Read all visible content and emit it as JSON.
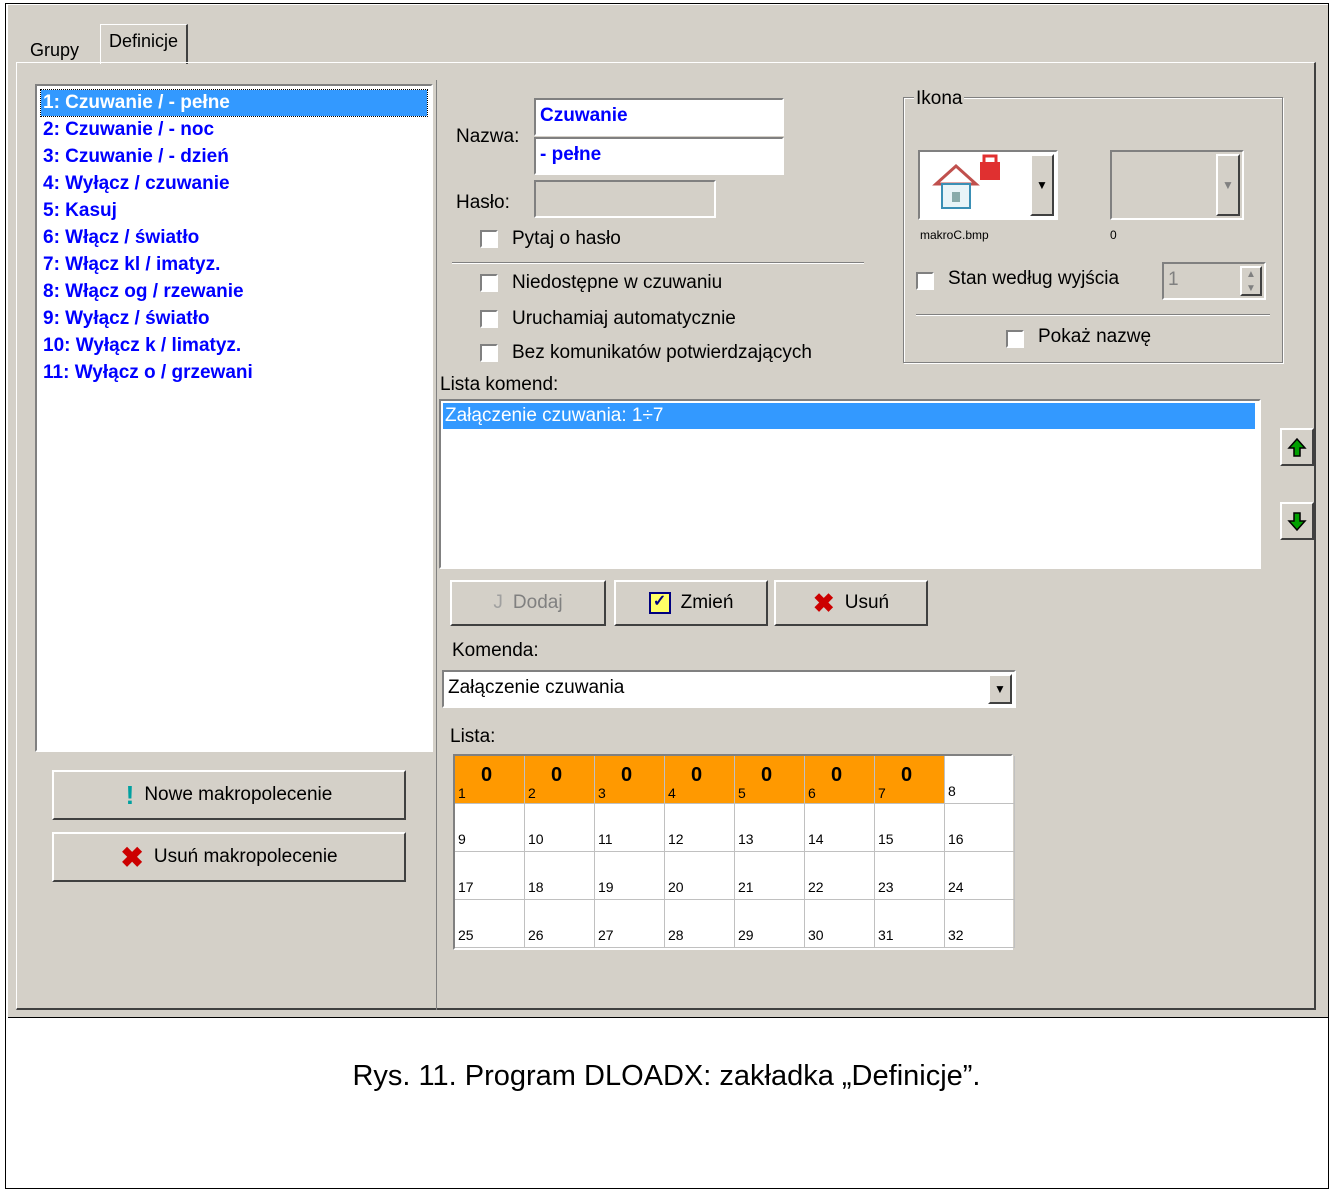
{
  "tabs": [
    {
      "label": "Grupy",
      "active": false
    },
    {
      "label": "Definicje",
      "active": true
    }
  ],
  "macro_list": {
    "items": [
      "1: Czuwanie /  - pełne",
      "2: Czuwanie /  - noc",
      "3: Czuwanie /  - dzień",
      "4: Wyłącz / czuwanie",
      "5: Kasuj",
      "6: Włącz  / światło",
      "7: Włącz kl / imatyz.",
      "8: Włącz og / rzewanie",
      "9: Wyłącz / światło",
      "10: Wyłącz k / limatyz.",
      "11: Wyłącz o / grzewani"
    ],
    "selected_index": 0
  },
  "left_buttons": {
    "new_macro": "Nowe makropolecenie",
    "delete_macro": "Usuń makropolecenie"
  },
  "form": {
    "name_label": "Nazwa:",
    "name_line1": "Czuwanie",
    "name_line2": "- pełne",
    "password_label": "Hasło:",
    "password_value": "",
    "ask_password": "Pytaj o hasło",
    "unavailable_armed": "Niedostępne w czuwaniu",
    "run_auto": "Uruchamiaj automatycznie",
    "no_confirm": "Bez komunikatów potwierdzających"
  },
  "icon_group": {
    "title": "Ikona",
    "icon1_file": "makroC.bmp",
    "icon2_file": "0",
    "state_by_output": "Stan według wyjścia",
    "output_value": "1",
    "show_name": "Pokaż nazwę"
  },
  "commands": {
    "label": "Lista komend:",
    "items": [
      "Załączenie czuwania: 1÷7"
    ],
    "add": "Dodaj",
    "change": "Zmień",
    "delete": "Usuń",
    "command_label": "Komenda:",
    "command_value": "Załączenie czuwania",
    "list_label": "Lista:"
  },
  "partition_grid": {
    "cells": [
      {
        "n": "1",
        "active": true,
        "mark": "0"
      },
      {
        "n": "2",
        "active": true,
        "mark": "0"
      },
      {
        "n": "3",
        "active": true,
        "mark": "0"
      },
      {
        "n": "4",
        "active": true,
        "mark": "0"
      },
      {
        "n": "5",
        "active": true,
        "mark": "0"
      },
      {
        "n": "6",
        "active": true,
        "mark": "0"
      },
      {
        "n": "7",
        "active": true,
        "mark": "0"
      },
      {
        "n": "8",
        "active": false,
        "mark": ""
      },
      {
        "n": "9",
        "active": false,
        "mark": ""
      },
      {
        "n": "10",
        "active": false,
        "mark": ""
      },
      {
        "n": "11",
        "active": false,
        "mark": ""
      },
      {
        "n": "12",
        "active": false,
        "mark": ""
      },
      {
        "n": "13",
        "active": false,
        "mark": ""
      },
      {
        "n": "14",
        "active": false,
        "mark": ""
      },
      {
        "n": "15",
        "active": false,
        "mark": ""
      },
      {
        "n": "16",
        "active": false,
        "mark": ""
      },
      {
        "n": "17",
        "active": false,
        "mark": ""
      },
      {
        "n": "18",
        "active": false,
        "mark": ""
      },
      {
        "n": "19",
        "active": false,
        "mark": ""
      },
      {
        "n": "20",
        "active": false,
        "mark": ""
      },
      {
        "n": "21",
        "active": false,
        "mark": ""
      },
      {
        "n": "22",
        "active": false,
        "mark": ""
      },
      {
        "n": "23",
        "active": false,
        "mark": ""
      },
      {
        "n": "24",
        "active": false,
        "mark": ""
      },
      {
        "n": "25",
        "active": false,
        "mark": ""
      },
      {
        "n": "26",
        "active": false,
        "mark": ""
      },
      {
        "n": "27",
        "active": false,
        "mark": ""
      },
      {
        "n": "28",
        "active": false,
        "mark": ""
      },
      {
        "n": "29",
        "active": false,
        "mark": ""
      },
      {
        "n": "30",
        "active": false,
        "mark": ""
      },
      {
        "n": "31",
        "active": false,
        "mark": ""
      },
      {
        "n": "32",
        "active": false,
        "mark": ""
      }
    ],
    "active_color": "#ff9900"
  },
  "colors": {
    "selection": "#3399ff",
    "macro_text": "#0000ff",
    "window_bg": "#d4d0c8"
  },
  "caption": "Rys. 11. Program DLOADX: zakładka „Definicje”."
}
